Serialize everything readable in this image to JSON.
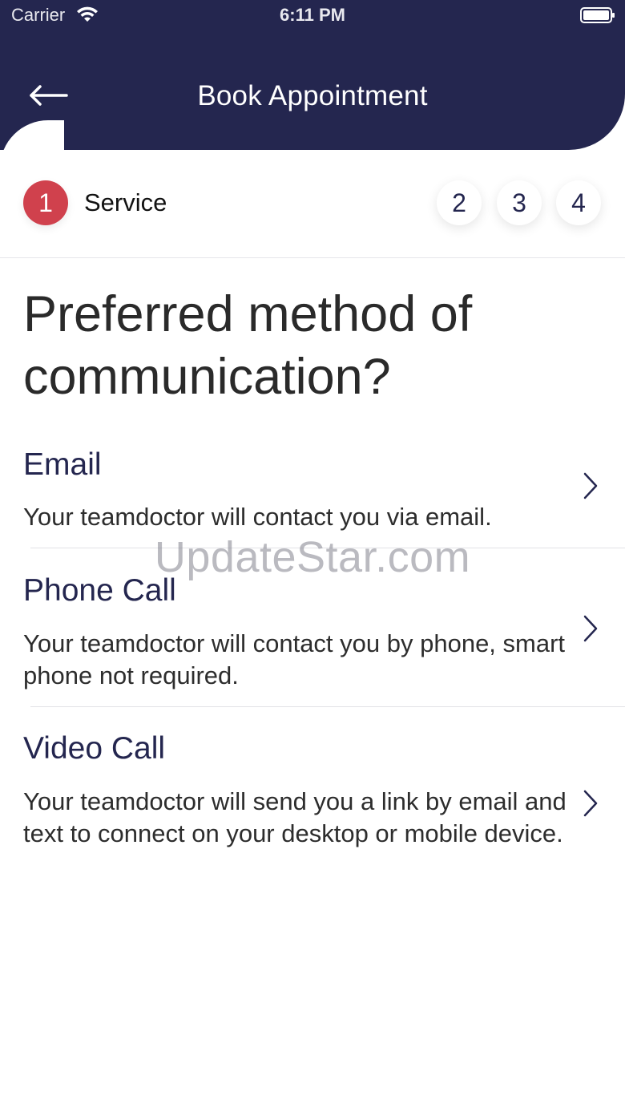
{
  "status_bar": {
    "carrier": "Carrier",
    "time": "6:11 PM",
    "wifi_icon": "wifi-icon",
    "battery_icon": "battery-icon"
  },
  "nav": {
    "back_icon": "arrow-left-icon",
    "title": "Book Appointment"
  },
  "stepper": {
    "active_step": "1",
    "active_label": "Service",
    "steps": [
      "2",
      "3",
      "4"
    ]
  },
  "question": "Preferred method of communication?",
  "options": [
    {
      "title": "Email",
      "description": "Your teamdoctor will contact you via email.",
      "icon": "chevron-right-icon"
    },
    {
      "title": "Phone Call",
      "description": "Your teamdoctor will contact you by phone, smart phone not required.",
      "icon": "chevron-right-icon"
    },
    {
      "title": "Video Call",
      "description": "Your teamdoctor will send you a link by email and text to connect on your desktop or mobile device.",
      "icon": "chevron-right-icon"
    }
  ],
  "watermark": "UpdateStar.com",
  "colors": {
    "header_bg": "#24264f",
    "active_step": "#d0414d",
    "title_text": "#24264f"
  }
}
